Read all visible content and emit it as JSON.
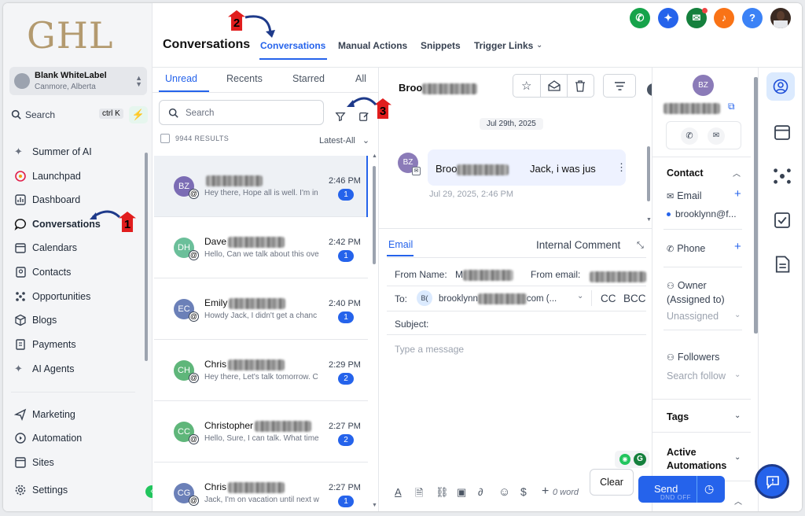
{
  "sidebar": {
    "logo": "GHL",
    "location_name": "Blank WhiteLabel",
    "location_city": "Canmore, Alberta",
    "search_label": "Search",
    "search_shortcut": "ctrl K",
    "nav_top": [
      "Summer of AI",
      "Launchpad",
      "Dashboard",
      "Conversations",
      "Calendars",
      "Contacts",
      "Opportunities",
      "Blogs",
      "Payments",
      "AI Agents"
    ],
    "nav_bottom": [
      "Marketing",
      "Automation",
      "Sites",
      "Settings"
    ],
    "active": "Conversations"
  },
  "header": {
    "title": "Conversations",
    "tabs": [
      "Conversations",
      "Manual Actions",
      "Snippets",
      "Trigger Links"
    ],
    "active_tab": "Conversations",
    "help_label": "?",
    "colors": {
      "phone": "#16a34a",
      "ai": "#2563eb",
      "announce": "#15803d",
      "bell": "#f97316",
      "help": "#3b82f6"
    }
  },
  "list": {
    "tabs": [
      "Unread",
      "Recents",
      "Starred",
      "All"
    ],
    "active_tab": "Unread",
    "search_placeholder": "Search",
    "results": "9944 RESULTS",
    "sort": "Latest-All",
    "rows": [
      {
        "initials": "BZ",
        "color": "#7b6cb4",
        "name": "",
        "time": "2:46 PM",
        "preview": "Hey there, Hope all is well. I'm in",
        "badge": "1",
        "selected": true
      },
      {
        "initials": "DH",
        "color": "#6bbf9a",
        "name": "Dave",
        "time": "2:42 PM",
        "preview": "Hello, Can we talk about this ove",
        "badge": "1"
      },
      {
        "initials": "EC",
        "color": "#6b80b8",
        "name": "Emily",
        "time": "2:40 PM",
        "preview": "Howdy Jack, I didn't get a chanc",
        "badge": "1"
      },
      {
        "initials": "CH",
        "color": "#5fb67a",
        "name": "Chris",
        "time": "2:29 PM",
        "preview": "Hey there, Let's talk tomorrow. C",
        "badge": "2"
      },
      {
        "initials": "CC",
        "color": "#5fb67a",
        "name": "Christopher",
        "time": "2:27 PM",
        "preview": "Hello, Sure, I can talk. What time",
        "badge": "2"
      },
      {
        "initials": "CG",
        "color": "#6b80b8",
        "name": "Chris",
        "time": "2:27 PM",
        "preview": "Jack, I'm on vacation until next w",
        "badge": "1"
      }
    ]
  },
  "thread": {
    "contact_name": "Broo",
    "date": "Jul 29th, 2025",
    "avatar": "BZ",
    "msg_from": "Broo",
    "msg_text": "Jack, i was jus",
    "msg_time": "Jul 29, 2025, 2:46 PM"
  },
  "compose": {
    "tab_email": "Email",
    "tab_internal": "Internal Comment",
    "from_name_label": "From Name:",
    "from_name_value": "M",
    "from_email_label": "From email:",
    "to_label": "To:",
    "to_avatar": "B(",
    "to_value_start": "brooklynn",
    "to_value_end": "com (...",
    "cc": "CC",
    "bcc": "BCC",
    "subject_label": "Subject:",
    "placeholder": "Type a message",
    "word_count": "0 word",
    "clear": "Clear",
    "send": "Send",
    "dnd": "DND OFF"
  },
  "contact_panel": {
    "avatar": "BZ",
    "contact_heading": "Contact",
    "email_label": "Email",
    "email_value": "brooklynn@f...",
    "phone_label": "Phone",
    "owner_label": "Owner (Assigned to)",
    "owner_value": "Unassigned",
    "followers_label": "Followers",
    "followers_placeholder": "Search follow",
    "tags": "Tags",
    "automations": "Active Automations"
  },
  "annotations": [
    "1",
    "2",
    "3"
  ]
}
